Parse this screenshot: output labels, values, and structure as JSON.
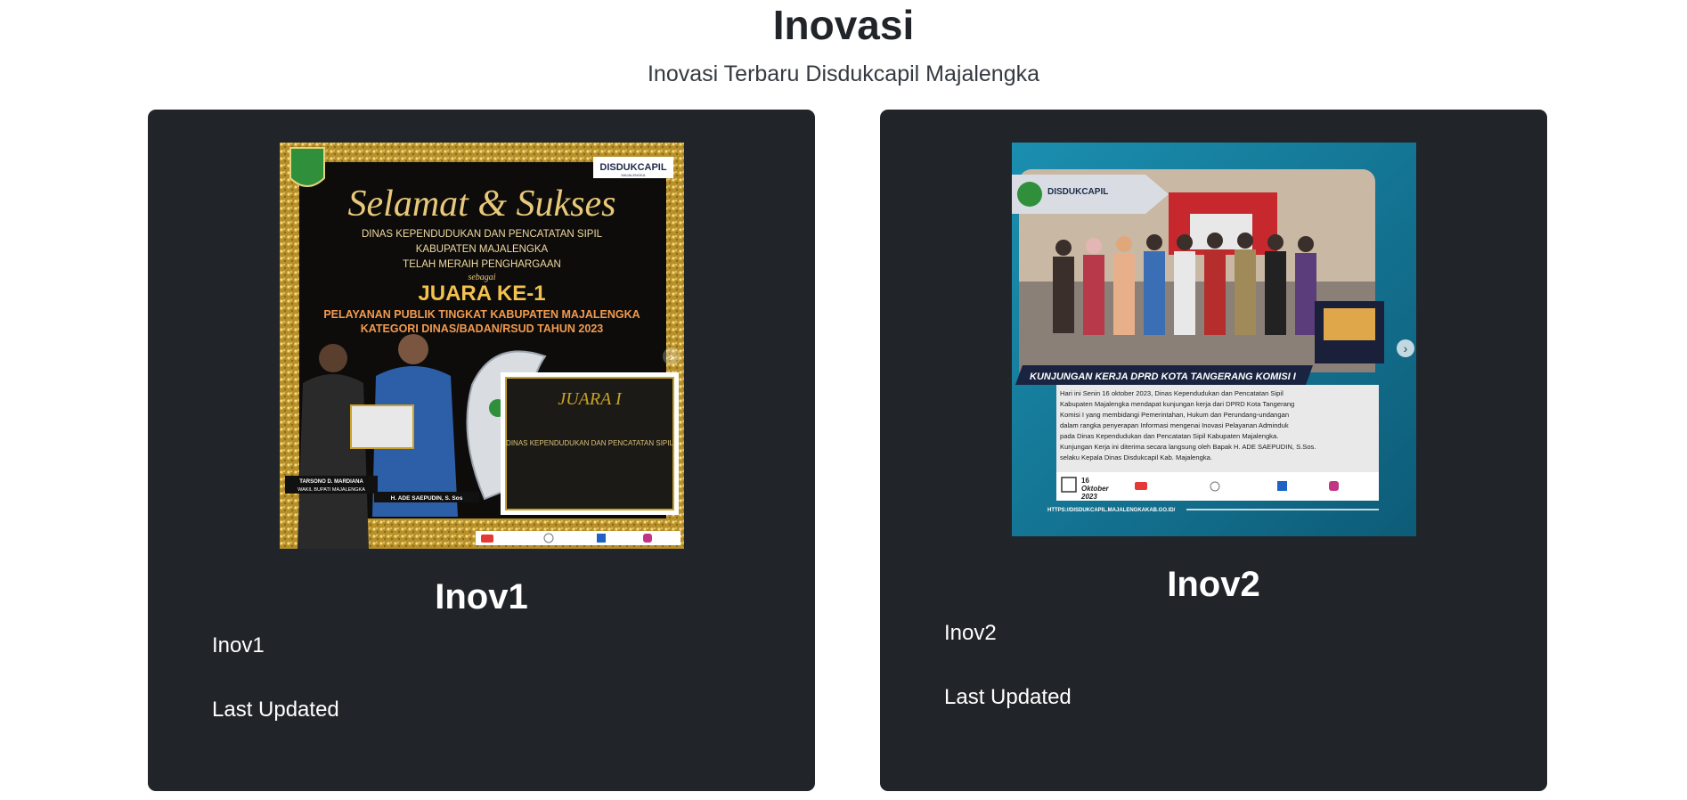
{
  "header": {
    "title": "Inovasi",
    "subtitle": "Inovasi Terbaru Disdukcapil Majalengka"
  },
  "cards": [
    {
      "title": "Inov1",
      "description": "Inov1",
      "updated_label": "Last Updated",
      "poster": {
        "brand": "DISDUKCAPIL",
        "brand_sub": "MAJALENGKA",
        "headline": "Selamat & Sukses",
        "line1": "DINAS KEPENDUDUKAN DAN PENCATATAN SIPIL",
        "line2": "KABUPATEN MAJALENGKA",
        "line3": "TELAH MERAIH PENGHARGAAN",
        "line4": "sebagai",
        "award": "JUARA KE-1",
        "line5": "PELAYANAN PUBLIK TINGKAT KABUPATEN MAJALENGKA",
        "line6": "KATEGORI DINAS/BADAN/RSUD TAHUN 2023",
        "person1": "TARSONO D. MARDIANA",
        "person1_role": "WAKIL BUPATI MAJALENGKA",
        "person2": "H. ADE SAEPUDIN, S. Sos",
        "plaque_title": "JUARA I",
        "plaque_text": "DINAS KEPENDUDUKAN DAN PENCATATAN SIPIL"
      }
    },
    {
      "title": "Inov2",
      "description": "Inov2",
      "updated_label": "Last Updated",
      "poster": {
        "brand": "DISDUKCAPIL",
        "banner": "KUNJUNGAN KERJA DPRD KOTA TANGERANG KOMISI I",
        "body1": "Hari ini Senin 16 oktober 2023, Dinas Kependudukan dan Pencatatan Sipil",
        "body2": "Kabupaten Majalengka mendapat kunjungan kerja dari DPRD Kota Tangerang",
        "body3": "Komisi I yang membidangi Pemerintahan, Hukum dan Perundang-undangan",
        "body4": "dalam rangka penyerapan Informasi mengenai Inovasi Pelayanan Adminduk",
        "body5": "pada Dinas Kependudukan dan Pencatatan Sipil Kabupaten Majalengka.",
        "body6": "Kunjungan Kerja ini diterima secara langsung oleh Bapak H. ADE SAEPUDIN, S.Sos.",
        "body7": "selaku Kepala Dinas Disdukcapil Kab. Majalengka.",
        "date_day": "16",
        "date_month": "Oktober",
        "date_year": "2023",
        "url": "HTTPS://DISDUKCAPIL.MAJALENGKAKAB.GO.ID/"
      }
    }
  ],
  "colors": {
    "card_bg": "#212428",
    "gold": "#c9a227",
    "award_gold": "#f2c14e",
    "teal": "#137a96"
  }
}
